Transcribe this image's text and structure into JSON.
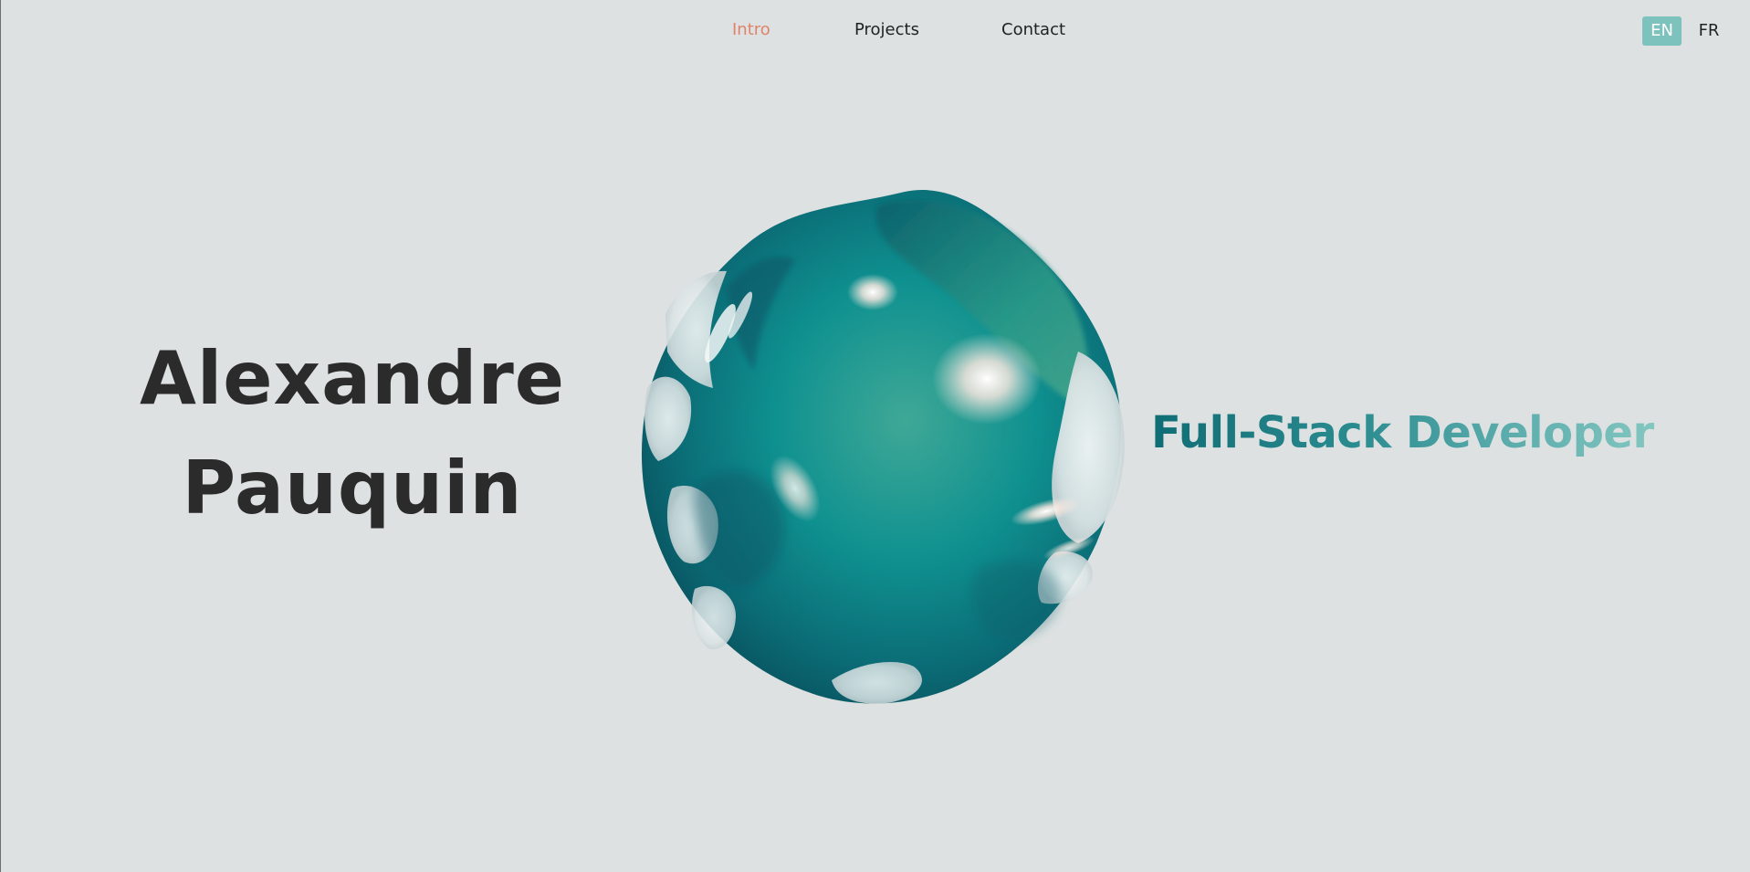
{
  "nav": {
    "items": [
      {
        "label": "Intro",
        "active": true
      },
      {
        "label": "Projects",
        "active": false
      },
      {
        "label": "Contact",
        "active": false
      }
    ],
    "active_color": "#e0836a"
  },
  "lang": {
    "options": [
      {
        "label": "EN",
        "active": true
      },
      {
        "label": "FR",
        "active": false
      }
    ],
    "active_bg": "#7ec2bd"
  },
  "hero": {
    "name_line1": "Alexandre",
    "name_line2": "Pauquin",
    "tagline": "Full-Stack Developer",
    "blob_colors": [
      "#0b5f6b",
      "#0d8f90",
      "#3a9e84",
      "#eaf2f2"
    ]
  }
}
